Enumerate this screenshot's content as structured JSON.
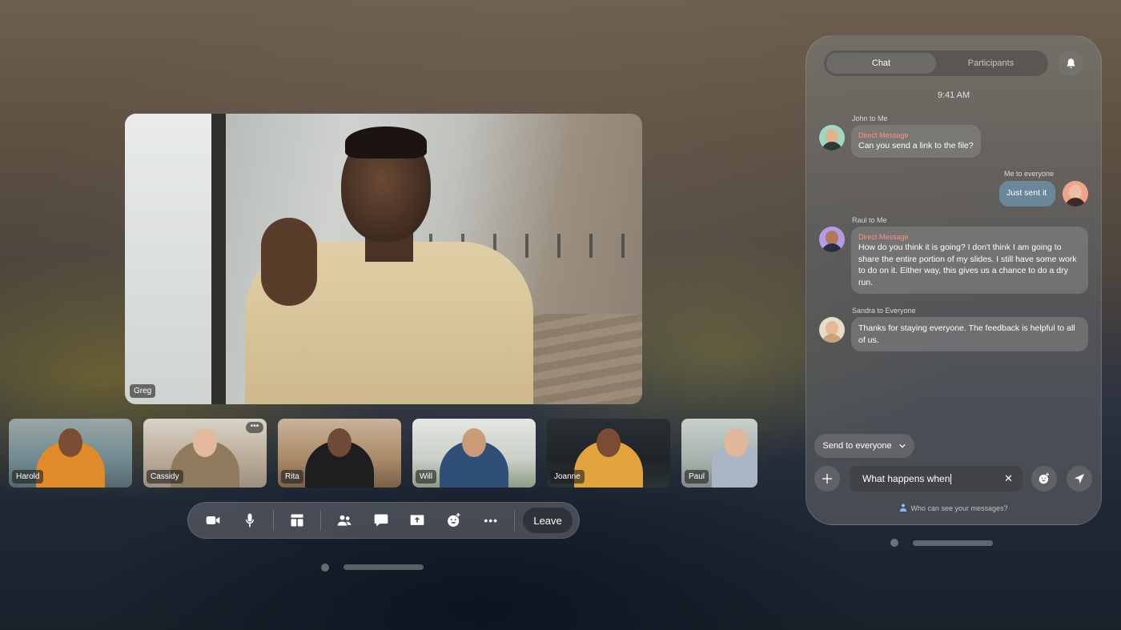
{
  "main_video": {
    "name": "Greg"
  },
  "thumbnails": [
    {
      "name": "Harold"
    },
    {
      "name": "Cassidy",
      "more": "•••"
    },
    {
      "name": "Rita"
    },
    {
      "name": "Will"
    },
    {
      "name": "Joanne"
    },
    {
      "name": "Paul"
    }
  ],
  "controls": {
    "leave_label": "Leave",
    "more_glyph": "•••"
  },
  "chat": {
    "tabs": [
      {
        "label": "Chat",
        "active": true
      },
      {
        "label": "Participants",
        "active": false
      }
    ],
    "time": "9:41 AM",
    "messages": [
      {
        "sender": "John to Me",
        "tag": "Direct Message",
        "text": "Can you send a link to the file?"
      },
      {
        "sender": "Me to everyone",
        "tag": "",
        "text": "Just sent it"
      },
      {
        "sender": "Raul to Me",
        "tag": "Direct Message",
        "text": "How do you think it is going? I don't think I am going to share the entire portion of my slides. I still have some work to do on it. Either way, this gives us a chance to do a dry run."
      },
      {
        "sender": "Sandra to Everyone",
        "tag": "",
        "text": "Thanks for staying everyone. The feedback is helpful to all of us."
      }
    ],
    "send_to": "Send to everyone",
    "input_value": "What happens when",
    "who_can_see": "Who can see your messages?"
  },
  "colors": {
    "direct_message": "#ff8f8a",
    "my_bubble": "#6e96af"
  }
}
